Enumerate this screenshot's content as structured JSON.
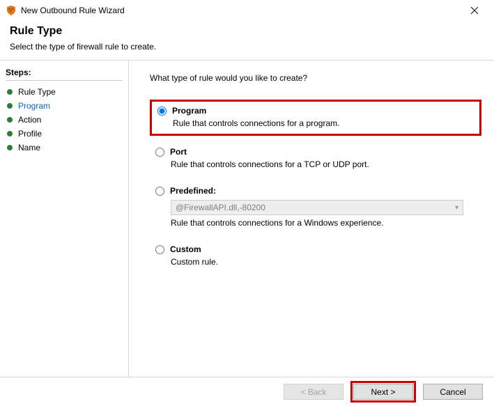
{
  "window": {
    "title": "New Outbound Rule Wizard"
  },
  "header": {
    "title": "Rule Type",
    "subtitle": "Select the type of firewall rule to create."
  },
  "sidebar": {
    "steps_label": "Steps:",
    "items": [
      {
        "label": "Rule Type"
      },
      {
        "label": "Program"
      },
      {
        "label": "Action"
      },
      {
        "label": "Profile"
      },
      {
        "label": "Name"
      }
    ]
  },
  "content": {
    "prompt": "What type of rule would you like to create?",
    "options": {
      "program": {
        "label": "Program",
        "desc": "Rule that controls connections for a program."
      },
      "port": {
        "label": "Port",
        "desc": "Rule that controls connections for a TCP or UDP port."
      },
      "predefined": {
        "label": "Predefined:",
        "select_value": "@FirewallAPI.dll,-80200",
        "desc": "Rule that controls connections for a Windows experience."
      },
      "custom": {
        "label": "Custom",
        "desc": "Custom rule."
      }
    }
  },
  "footer": {
    "back": "< Back",
    "next": "Next >",
    "cancel": "Cancel"
  }
}
